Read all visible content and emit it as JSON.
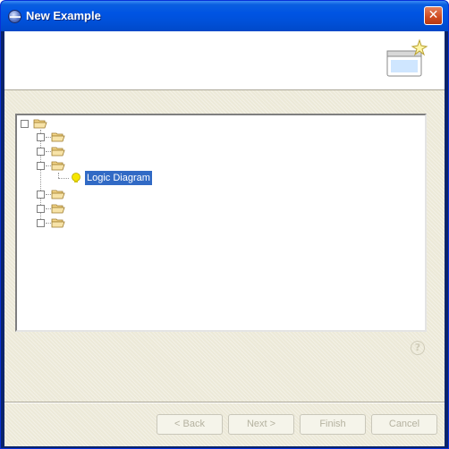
{
  "window": {
    "title": "New Example",
    "close_glyph": "✕"
  },
  "tree": {
    "nodes": [
      {
        "icon": "folder-open-icon",
        "label": ""
      },
      {
        "icon": "folder-open-icon",
        "label": ""
      },
      {
        "icon": "folder-open-icon",
        "label": ""
      },
      {
        "icon": "folder-open-icon",
        "label": ""
      },
      {
        "icon": "folder-open-icon",
        "label": ""
      },
      {
        "icon": "folder-open-icon",
        "label": ""
      },
      {
        "icon": "folder-open-icon",
        "label": ""
      }
    ],
    "selected_item": {
      "icon": "bulb-icon",
      "label": "Logic Diagram"
    }
  },
  "help": {
    "glyph": "?"
  },
  "buttons": {
    "back": "< Back",
    "next": "Next >",
    "finish": "Finish",
    "cancel": "Cancel"
  }
}
